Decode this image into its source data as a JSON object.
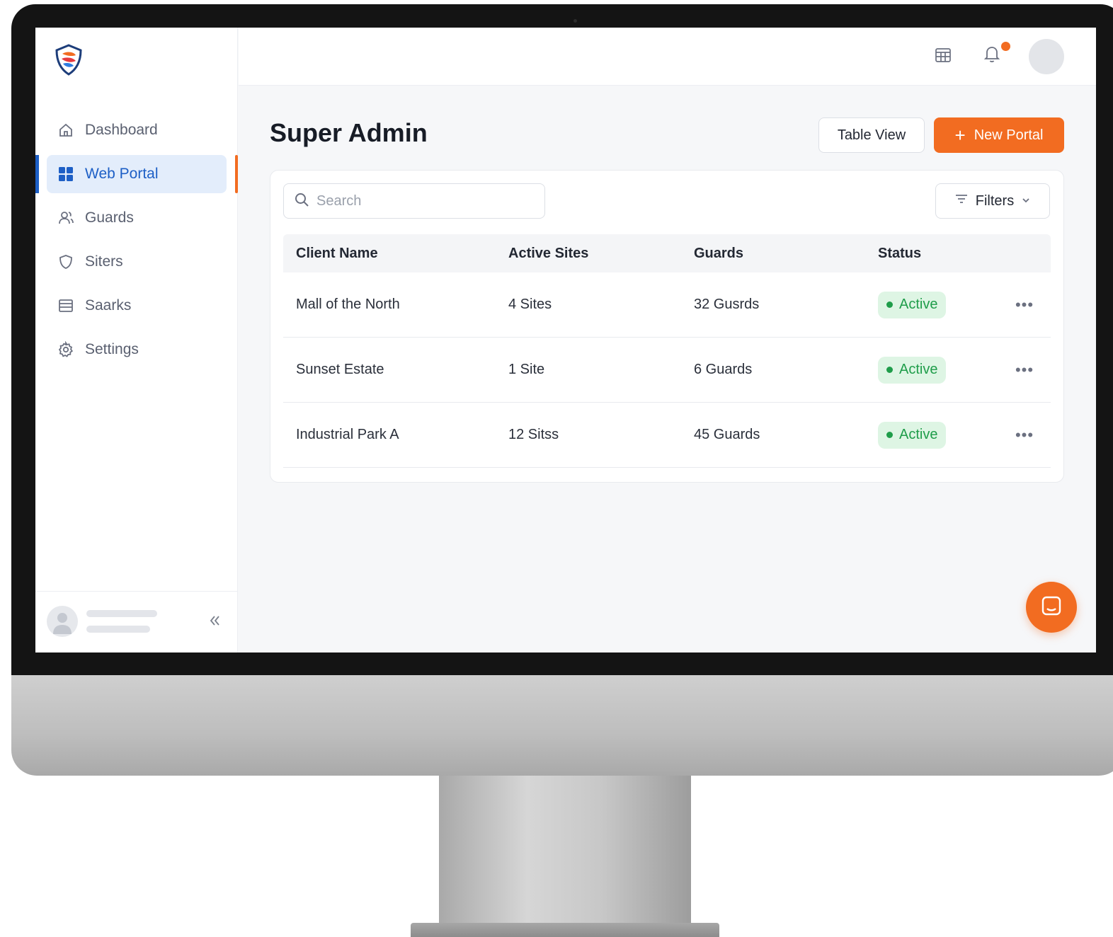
{
  "app": {
    "nav": [
      {
        "label": "Dashboard",
        "icon": "home-icon",
        "active": false
      },
      {
        "label": "Web Portal",
        "icon": "grid-icon",
        "active": true
      },
      {
        "label": "Guards",
        "icon": "users-icon",
        "active": false
      },
      {
        "label": "Siters",
        "icon": "shield-icon",
        "active": false
      },
      {
        "label": "Saarks",
        "icon": "list-icon",
        "active": false
      },
      {
        "label": "Settings",
        "icon": "gear-icon",
        "active": false
      }
    ]
  },
  "page": {
    "title": "Super Admin",
    "table_view_label": "Table View",
    "new_portal_label": "New Portal",
    "new_portal_icon": "plus-icon"
  },
  "toolbar": {
    "search_placeholder": "Search",
    "search_value": "",
    "filters_label": "Filters"
  },
  "table": {
    "columns": [
      "Client Name",
      "Active Sites",
      "Guards",
      "Status"
    ],
    "rows": [
      {
        "client": "Mall of the North",
        "sites": "4 Sites",
        "guards": "32 Gusrds",
        "status": "Active"
      },
      {
        "client": "Sunset Estate",
        "sites": "1 Site",
        "guards": "6 Guards",
        "status": "Active"
      },
      {
        "client": "Industrial Park A",
        "sites": "12 Sitss",
        "guards": "45 Guards",
        "status": "Active"
      }
    ]
  },
  "colors": {
    "accent": "#f26c21",
    "primary": "#1d5fc6",
    "status_active": "#1f9d4a",
    "status_active_bg": "#def5e4"
  }
}
